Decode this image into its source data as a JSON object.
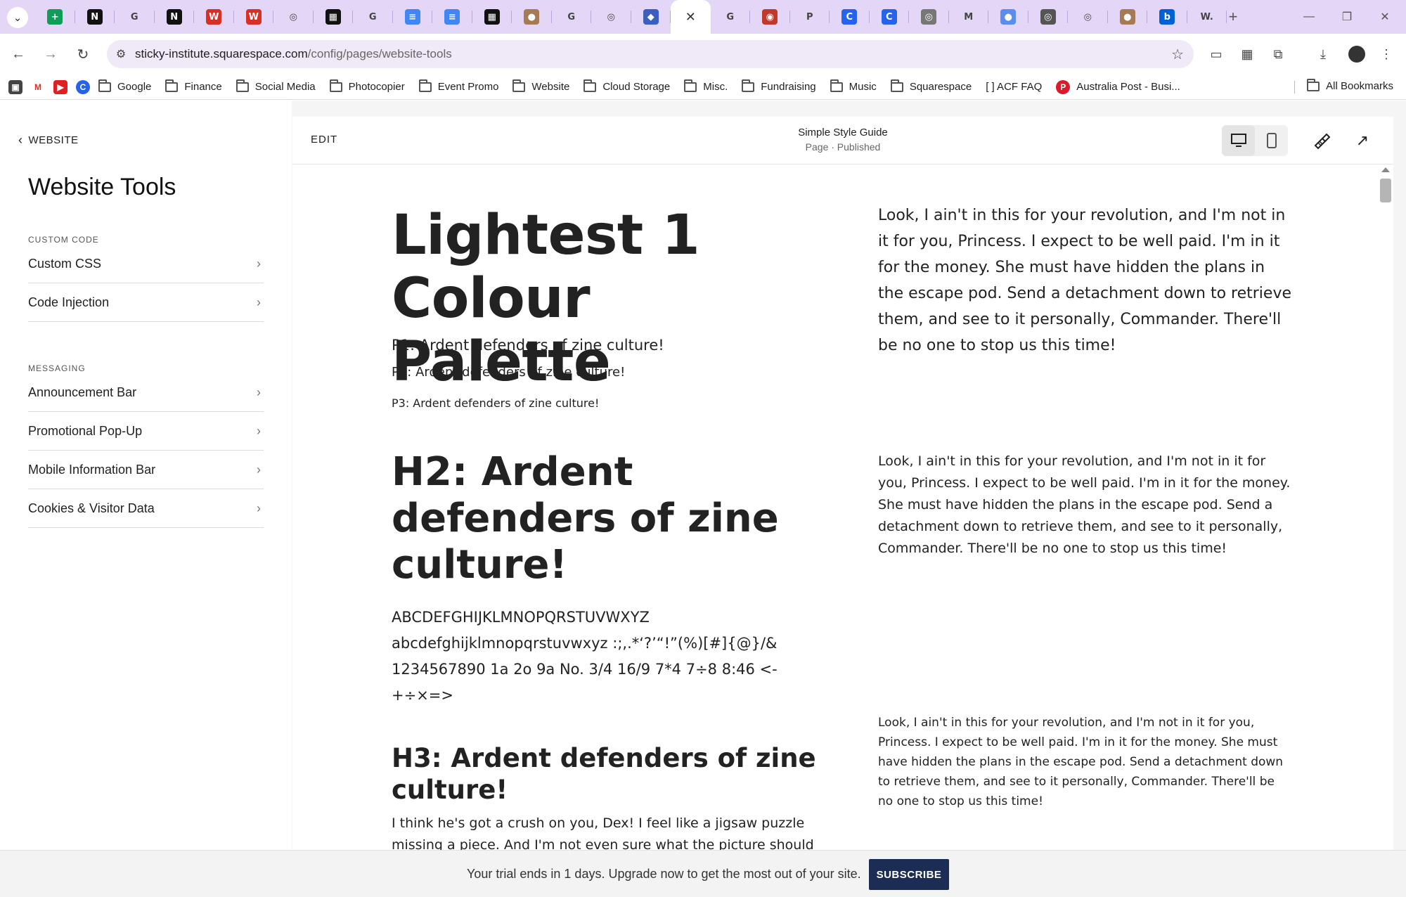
{
  "browser": {
    "tabs": [
      {
        "icon": "google-sheets-icon",
        "color": "#0f9d58",
        "glyph": "+"
      },
      {
        "icon": "notion-icon",
        "color": "#111111",
        "glyph": "N"
      },
      {
        "icon": "google-icon",
        "color": "#ffffff",
        "glyph": "G"
      },
      {
        "icon": "notion-icon",
        "color": "#111111",
        "glyph": "N"
      },
      {
        "icon": "webflow-icon",
        "color": "#d93025",
        "glyph": "W"
      },
      {
        "icon": "webflow-icon",
        "color": "#d93025",
        "glyph": "W"
      },
      {
        "icon": "squarespace-icon",
        "color": "#ffffff",
        "glyph": "◎"
      },
      {
        "icon": "qr-icon",
        "color": "#111111",
        "glyph": "▦"
      },
      {
        "icon": "google-icon",
        "color": "#ffffff",
        "glyph": "G"
      },
      {
        "icon": "google-docs-icon",
        "color": "#4285f4",
        "glyph": "≡"
      },
      {
        "icon": "google-docs-icon",
        "color": "#4285f4",
        "glyph": "≡"
      },
      {
        "icon": "qr-icon",
        "color": "#111111",
        "glyph": "▦"
      },
      {
        "icon": "sticky-institute-icon",
        "color": "#a57a55",
        "glyph": "●"
      },
      {
        "icon": "google-icon",
        "color": "#ffffff",
        "glyph": "G"
      },
      {
        "icon": "squarespace-icon",
        "color": "#ffffff",
        "glyph": "◎"
      },
      {
        "icon": "shield-icon",
        "color": "#3b5fc0",
        "glyph": "◆"
      },
      {
        "icon": "close-icon",
        "color": "#ffffff",
        "glyph": "✕",
        "active": true
      },
      {
        "icon": "google-icon",
        "color": "#ffffff",
        "glyph": "G"
      },
      {
        "icon": "target-icon",
        "color": "#c0392b",
        "glyph": "◉"
      },
      {
        "icon": "p-icon",
        "color": "#ffffff",
        "glyph": "P"
      },
      {
        "icon": "c-icon",
        "color": "#2563eb",
        "glyph": "C"
      },
      {
        "icon": "c-icon",
        "color": "#2563eb",
        "glyph": "C"
      },
      {
        "icon": "chrome-icon",
        "color": "#777777",
        "glyph": "◎"
      },
      {
        "icon": "gmail-icon",
        "color": "#ffffff",
        "glyph": "M"
      },
      {
        "icon": "profile-icon",
        "color": "#5b8def",
        "glyph": "●"
      },
      {
        "icon": "chrome-icon",
        "color": "#555555",
        "glyph": "◎"
      },
      {
        "icon": "squarespace-icon",
        "color": "#ffffff",
        "glyph": "◎"
      },
      {
        "icon": "sticky-institute-icon",
        "color": "#a57a55",
        "glyph": "●"
      },
      {
        "icon": "box-icon",
        "color": "#0061d5",
        "glyph": "b"
      },
      {
        "icon": "wix-icon",
        "color": "#ffffff",
        "glyph": "W."
      }
    ],
    "url_host": "sticky-institute.squarespace.com",
    "url_path": "/config/pages/website-tools",
    "bookmarks": [
      {
        "label": "Google"
      },
      {
        "label": "Finance"
      },
      {
        "label": "Social Media"
      },
      {
        "label": "Photocopier"
      },
      {
        "label": "Event Promo"
      },
      {
        "label": "Website"
      },
      {
        "label": "Cloud Storage"
      },
      {
        "label": "Misc."
      },
      {
        "label": "Fundraising"
      },
      {
        "label": "Music"
      },
      {
        "label": "Squarespace"
      }
    ],
    "bookmark_acf": "[ ] ACF FAQ",
    "bookmark_auspost": "Australia Post - Busi...",
    "all_bookmarks": "All Bookmarks"
  },
  "sidebar": {
    "back_label": "WEBSITE",
    "title": "Website Tools",
    "section_custom_code": "CUSTOM CODE",
    "custom_code_items": [
      {
        "label": "Custom CSS"
      },
      {
        "label": "Code Injection"
      }
    ],
    "section_messaging": "MESSAGING",
    "messaging_items": [
      {
        "label": "Announcement Bar"
      },
      {
        "label": "Promotional Pop-Up"
      },
      {
        "label": "Mobile Information Bar"
      },
      {
        "label": "Cookies & Visitor Data"
      }
    ]
  },
  "editor": {
    "edit_label": "EDIT",
    "page_title": "Simple Style Guide",
    "page_status": "Page · Published"
  },
  "content": {
    "h1": "Lightest 1 Colour Palette",
    "p1": "P1: Ardent defenders of zine culture!",
    "p2": "P2: Ardent defenders of zine culture!",
    "p3": "P3: Ardent defenders of zine culture!",
    "h2": "H2: Ardent defenders of zine culture!",
    "glyphs": "ABCDEFGHIJKLMNOPQRSTUVWXYZ abcdefghijklmnopqrstuvwxyz :;,.*‘?’“!”(%)[#]{@}/& 1234567890 1a 2o 9a No. 3/4 16/9 7*4 7÷8 8:46 <-+÷×=>",
    "h3": "H3: Ardent defenders of zine culture!",
    "body": "I think he's got a crush on you, Dex! I feel like a jigsaw puzzle missing a piece. And I'm not even sure what the picture should be.",
    "right_text_1": "Look, I ain't in this for your revolution, and I'm not in it for you, Princess. I expect to be well paid. I'm in it for the money. She must have hidden the plans in the escape pod. Send a detachment down to retrieve them, and see to it personally, Commander. There'll be no one to stop us this time!",
    "right_text_2": "Look, I ain't in this for your revolution, and I'm not in it for you, Princess. I expect to be well paid. I'm in it for the money. She must have hidden the plans in the escape pod. Send a detachment down to retrieve them, and see to it personally, Commander. There'll be no one to stop us this time!",
    "right_text_3": "Look, I ain't in this for your revolution, and I'm not in it for you, Princess. I expect to be well paid. I'm in it for the money. She must have hidden the plans in the escape pod. Send a detachment down to retrieve them, and see to it personally, Commander. There'll be no one to stop us this time!"
  },
  "trial": {
    "message": "Your trial ends in 1 days. Upgrade now to get the most out of your site.",
    "subscribe_label": "SUBSCRIBE"
  },
  "colors": {
    "tabstrip": "#e3d6f6",
    "subscribe": "#1b2c55",
    "editor_bg": "#f5f5f5"
  }
}
